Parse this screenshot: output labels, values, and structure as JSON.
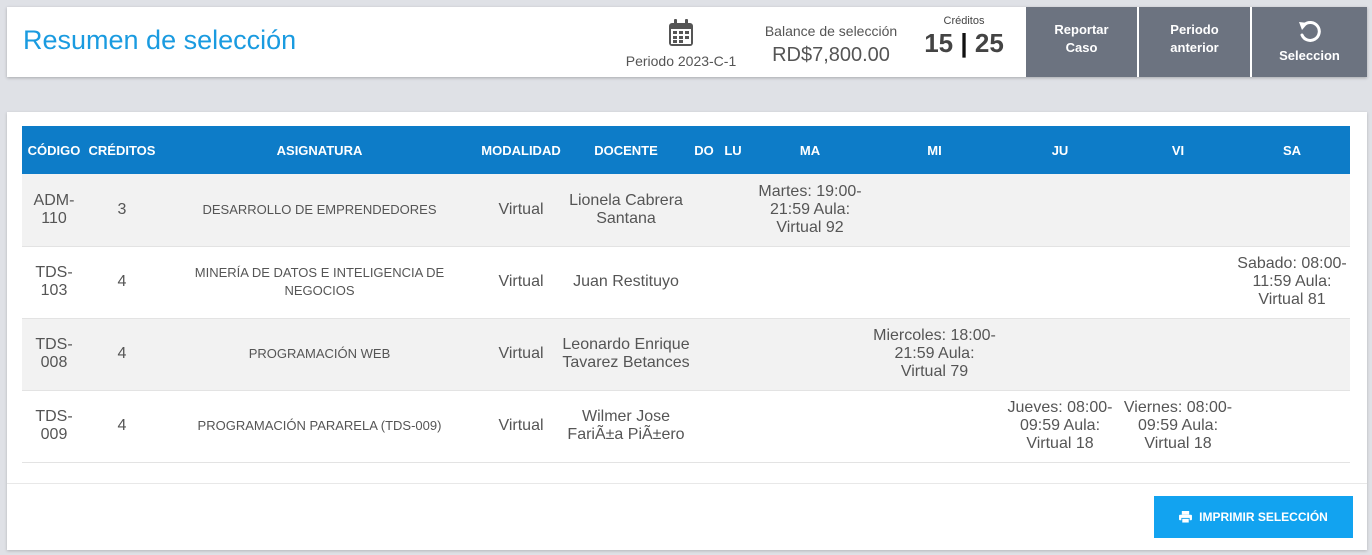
{
  "header": {
    "title": "Resumen de selección",
    "period_label": "Periodo 2023-C-1",
    "balance_label": "Balance de selección",
    "balance_value": "RD$7,800.00",
    "credits_label": "Créditos",
    "credits_used": "15",
    "credits_separator": "|",
    "credits_total": "25",
    "buttons": {
      "report_line1": "Reportar",
      "report_line2": "Caso",
      "previous_line1": "Periodo",
      "previous_line2": "anterior",
      "selection_label": "Seleccion"
    }
  },
  "table": {
    "headers": [
      "CÓDIGO",
      "CRÉDITOS",
      "ASIGNATURA",
      "MODALIDAD",
      "DOCENTE",
      "DO",
      "LU",
      "MA",
      "MI",
      "JU",
      "VI",
      "SA"
    ],
    "rows": [
      {
        "code": "ADM-110",
        "credits": "3",
        "subject": "DESARROLLO DE EMPRENDEDORES",
        "mode": "Virtual",
        "teacher": "Lionela Cabrera Santana",
        "do": "",
        "lu": "",
        "ma": "Martes: 19:00-21:59 Aula: Virtual 92",
        "mi": "",
        "ju": "",
        "vi": "",
        "sa": ""
      },
      {
        "code": "TDS-103",
        "credits": "4",
        "subject": "MINERÍA DE DATOS E INTELIGENCIA DE NEGOCIOS",
        "mode": "Virtual",
        "teacher": "Juan Restituyo",
        "do": "",
        "lu": "",
        "ma": "",
        "mi": "",
        "ju": "",
        "vi": "",
        "sa": "Sabado: 08:00-11:59 Aula: Virtual 81"
      },
      {
        "code": "TDS-008",
        "credits": "4",
        "subject": "PROGRAMACIÓN WEB",
        "mode": "Virtual",
        "teacher": "Leonardo Enrique Tavarez Betances",
        "do": "",
        "lu": "",
        "ma": "",
        "mi": "Miercoles: 18:00-21:59 Aula: Virtual 79",
        "ju": "",
        "vi": "",
        "sa": ""
      },
      {
        "code": "TDS-009",
        "credits": "4",
        "subject": "PROGRAMACIÓN PARARELA (TDS-009)",
        "mode": "Virtual",
        "teacher": "Wilmer Jose FariÃ±a PiÃ±ero",
        "do": "",
        "lu": "",
        "ma": "",
        "mi": "",
        "ju": "Jueves: 08:00-09:59 Aula: Virtual 18",
        "vi": "Viernes: 08:00-09:59 Aula: Virtual 18",
        "sa": ""
      }
    ]
  },
  "print_button_label": "IMPRIMIR SELECCIÓN",
  "icons": {
    "period": "calendar-icon",
    "selection": "undo-icon",
    "print": "printer-icon"
  },
  "colors": {
    "title": "#1a9be0",
    "table_header": "#0d7cc8",
    "header_buttons": "#6c7380",
    "print_button": "#12a3f0"
  }
}
